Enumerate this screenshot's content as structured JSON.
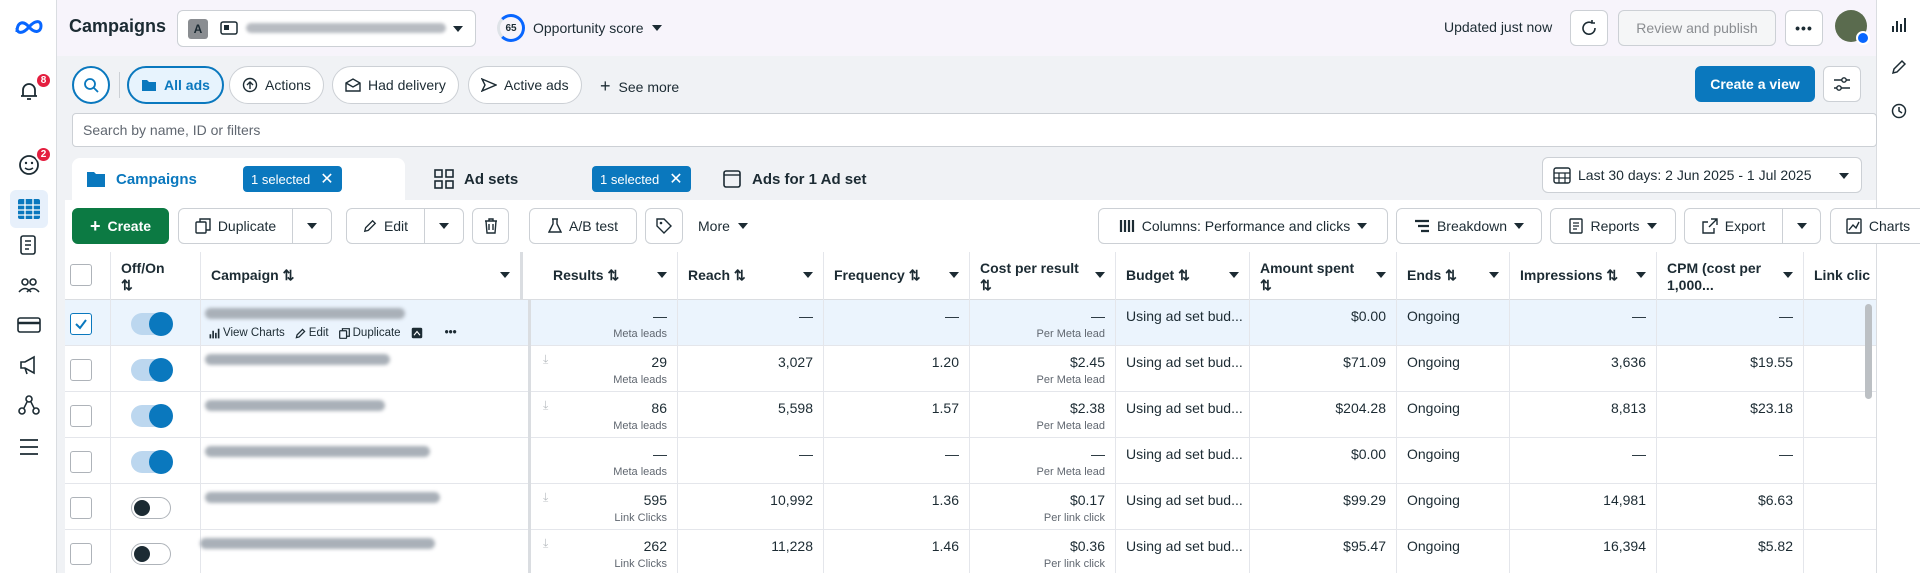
{
  "left_nav": {
    "notifications_badge": "8",
    "activity_badge": "2"
  },
  "header": {
    "title": "Campaigns",
    "account_badge": "A",
    "opportunity_value": "65",
    "opportunity_label": "Opportunity score",
    "updated_text": "Updated just now",
    "review_publish_label": "Review and publish"
  },
  "filter_bar": {
    "pills": [
      {
        "label": "All ads",
        "active": true,
        "icon": "folder-icon"
      },
      {
        "label": "Actions",
        "active": false,
        "icon": "arrow-circle-icon"
      },
      {
        "label": "Had delivery",
        "active": false,
        "icon": "envelope-icon"
      },
      {
        "label": "Active ads",
        "active": false,
        "icon": "send-icon"
      }
    ],
    "see_more_label": "See more",
    "create_view_label": "Create a view"
  },
  "search": {
    "placeholder": "Search by name, ID or filters"
  },
  "tabs": [
    {
      "label": "Campaigns",
      "selected_chip": "1 selected",
      "active": true
    },
    {
      "label": "Ad sets",
      "selected_chip": "1 selected",
      "active": false
    },
    {
      "label": "Ads for 1 Ad set",
      "active": false
    }
  ],
  "date_range": "Last 30 days: 2 Jun 2025 - 1 Jul 2025",
  "toolbar": {
    "create_label": "Create",
    "duplicate_label": "Duplicate",
    "edit_label": "Edit",
    "ab_test_label": "A/B test",
    "more_label": "More",
    "columns_label": "Columns: Performance and clicks",
    "breakdown_label": "Breakdown",
    "reports_label": "Reports",
    "export_label": "Export",
    "charts_label": "Charts"
  },
  "table": {
    "headers": {
      "off_on": "Off/On",
      "campaign": "Campaign",
      "results": "Results",
      "reach": "Reach",
      "frequency": "Frequency",
      "cost_per_result": "Cost per result",
      "budget": "Budget",
      "amount_spent": "Amount spent",
      "ends": "Ends",
      "impressions": "Impressions",
      "cpm": "CPM (cost per 1,000...",
      "link_clicks": "Link clic"
    },
    "row_actions": {
      "view_charts": "View Charts",
      "edit": "Edit",
      "duplicate": "Duplicate"
    },
    "rows": [
      {
        "checked": true,
        "on": true,
        "results": "—",
        "results_type": "Meta leads",
        "reach": "—",
        "frequency": "—",
        "cost": "—",
        "cost_type": "Per Meta lead",
        "budget": "Using ad set bud...",
        "spent": "$0.00",
        "ends": "Ongoing",
        "impressions": "—",
        "cpm": "—",
        "name_fragment": "3 | USA"
      },
      {
        "checked": false,
        "on": true,
        "results": "29",
        "results_type": "Meta leads",
        "reach": "3,027",
        "frequency": "1.20",
        "cost": "$2.45",
        "cost_type": "Per Meta lead",
        "budget": "Using ad set bud...",
        "spent": "$71.09",
        "ends": "Ongoing",
        "impressions": "3,636",
        "cpm": "$19.55",
        "name_fragment": "Leads campaign | 2"
      },
      {
        "checked": false,
        "on": true,
        "results": "86",
        "results_type": "Meta leads",
        "reach": "5,598",
        "frequency": "1.57",
        "cost": "$2.38",
        "cost_type": "Per Meta lead",
        "budget": "Using ad set bud...",
        "spent": "$204.28",
        "ends": "Ongoing",
        "impressions": "8,813",
        "cpm": "$23.18",
        "name_fragment": ""
      },
      {
        "checked": false,
        "on": true,
        "results": "—",
        "results_type": "Meta leads",
        "reach": "—",
        "frequency": "—",
        "cost": "—",
        "cost_type": "Per Meta lead",
        "budget": "Using ad set bud...",
        "spent": "$0.00",
        "ends": "Ongoing",
        "impressions": "—",
        "cpm": "—",
        "name_fragment": "Leads campaign | 1 | USA"
      },
      {
        "checked": false,
        "on": false,
        "results": "595",
        "results_type": "Link Clicks",
        "reach": "10,992",
        "frequency": "1.36",
        "cost": "$0.17",
        "cost_type": "Per link click",
        "budget": "Using ad set bud...",
        "spent": "$99.29",
        "ends": "Ongoing",
        "impressions": "14,981",
        "cpm": "$6.63",
        "name_fragment": "Landing Page"
      },
      {
        "checked": false,
        "on": false,
        "results": "262",
        "results_type": "Link Clicks",
        "reach": "11,228",
        "frequency": "1.46",
        "cost": "$0.36",
        "cost_type": "Per link click",
        "budget": "Using ad set bud...",
        "spent": "$95.47",
        "ends": "Ongoing",
        "impressions": "16,394",
        "cpm": "$5.82",
        "name_fragment": "Landing P"
      }
    ]
  },
  "colors": {
    "primary": "#0a78be",
    "create_green": "#0c7a43",
    "badge_red": "#e41e3f",
    "meta_blue": "#0866ff"
  }
}
